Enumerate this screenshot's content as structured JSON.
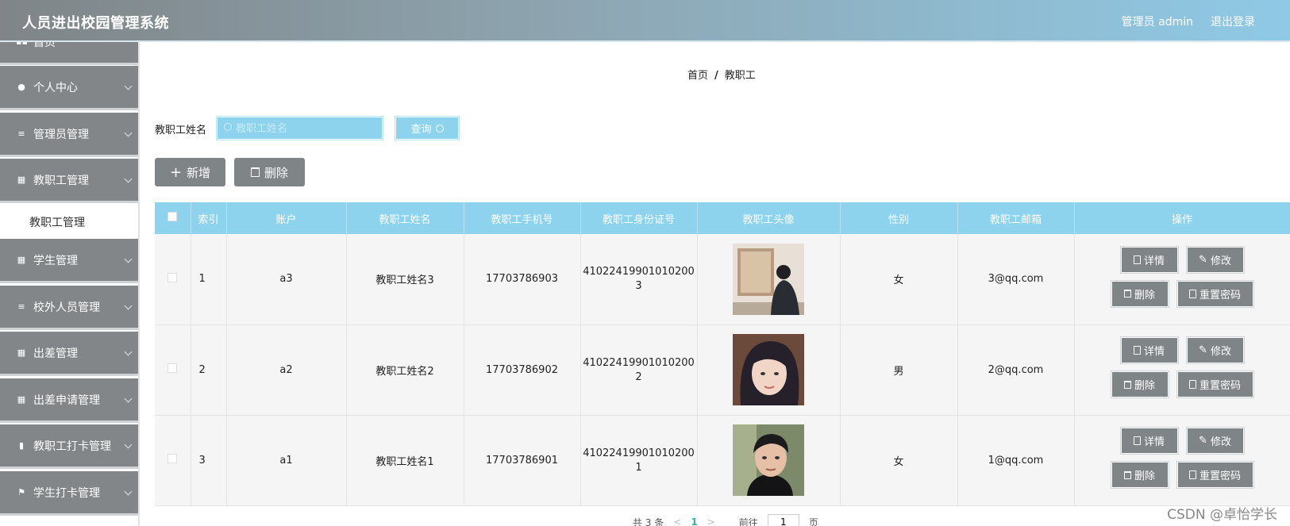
{
  "header": {
    "title": "人员进出校园管理系统",
    "user_label": "管理员 admin",
    "logout_label": "退出登录"
  },
  "sidebar": {
    "items": [
      {
        "label": "首页",
        "icon": "home-icon"
      },
      {
        "label": "个人中心",
        "icon": "person-icon"
      },
      {
        "label": "管理员管理",
        "icon": "menu-icon"
      },
      {
        "label": "教职工管理",
        "icon": "grid-icon"
      },
      {
        "label": "学生管理",
        "icon": "grid-icon"
      },
      {
        "label": "校外人员管理",
        "icon": "menu-icon"
      },
      {
        "label": "出差管理",
        "icon": "grid-icon"
      },
      {
        "label": "出差申请管理",
        "icon": "grid-icon"
      },
      {
        "label": "教职工打卡管理",
        "icon": "bar-chart-icon"
      },
      {
        "label": "学生打卡管理",
        "icon": "flag-icon"
      }
    ],
    "submenu": {
      "label": "教职工管理"
    }
  },
  "breadcrumb": {
    "home": "首页",
    "separator": "/",
    "current": "教职工"
  },
  "search": {
    "label": "教职工姓名",
    "placeholder": "教职工姓名",
    "value": "",
    "button_label": "查询"
  },
  "actions": {
    "add_label": "新增",
    "delete_label": "删除"
  },
  "table": {
    "columns": [
      "索引",
      "账户",
      "教职工姓名",
      "教职工手机号",
      "教职工身份证号",
      "教职工头像",
      "性别",
      "教职工邮箱",
      "操作"
    ],
    "rows": [
      {
        "index": "1",
        "account": "a3",
        "name": "教职工姓名3",
        "phone": "17703786903",
        "id_line1": "41022419901010200",
        "id_line2": "3",
        "gender": "女",
        "email": "3@qq.com"
      },
      {
        "index": "2",
        "account": "a2",
        "name": "教职工姓名2",
        "phone": "17703786902",
        "id_line1": "41022419901010200",
        "id_line2": "2",
        "gender": "男",
        "email": "2@qq.com"
      },
      {
        "index": "3",
        "account": "a1",
        "name": "教职工姓名1",
        "phone": "17703786901",
        "id_line1": "41022419901010200",
        "id_line2": "1",
        "gender": "女",
        "email": "1@qq.com"
      }
    ],
    "row_actions": {
      "detail": "详情",
      "edit": "修改",
      "delete": "删除",
      "reset": "重置密码"
    }
  },
  "pagination": {
    "total_text": "共 3 条",
    "current_page": "1",
    "goto_label": "前往",
    "goto_value": "1",
    "page_suffix": "页"
  },
  "watermark": "CSDN @卓怡学长",
  "colors": {
    "header_start": "#7f8588",
    "header_end": "#8fc9e6",
    "sidebar": "#828689",
    "accent": "#8dd3ee",
    "button": "#7f8487"
  }
}
